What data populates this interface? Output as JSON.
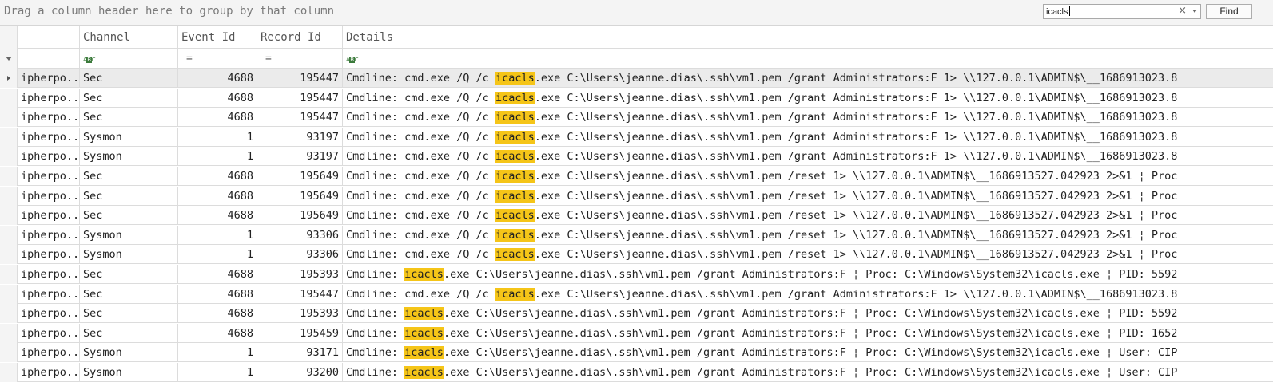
{
  "group_panel": {
    "hint": "Drag a column header here to group by that column"
  },
  "find": {
    "query": "icacls",
    "button_label": "Find"
  },
  "columns": {
    "c1": "",
    "c2": "Channel",
    "c3": "Event Id",
    "c4": "Record Id",
    "c5": "Details"
  },
  "filter_row": {
    "c3": "=",
    "c4": "="
  },
  "highlight_color": "#f5c518",
  "rows": [
    {
      "c1": "ipherpo...",
      "c2": "Sec",
      "c3": "4688",
      "c4": "195447",
      "pre": "Cmdline: cmd.exe /Q /c ",
      "hl": "icacls",
      "post": ".exe C:\\Users\\jeanne.dias\\.ssh\\vm1.pem /grant Administrators:F 1> \\\\127.0.0.1\\ADMIN$\\__1686913023.8"
    },
    {
      "c1": "ipherpo...",
      "c2": "Sec",
      "c3": "4688",
      "c4": "195447",
      "pre": "Cmdline: cmd.exe /Q /c ",
      "hl": "icacls",
      "post": ".exe C:\\Users\\jeanne.dias\\.ssh\\vm1.pem /grant Administrators:F 1> \\\\127.0.0.1\\ADMIN$\\__1686913023.8"
    },
    {
      "c1": "ipherpo...",
      "c2": "Sec",
      "c3": "4688",
      "c4": "195447",
      "pre": "Cmdline: cmd.exe /Q /c ",
      "hl": "icacls",
      "post": ".exe C:\\Users\\jeanne.dias\\.ssh\\vm1.pem /grant Administrators:F 1> \\\\127.0.0.1\\ADMIN$\\__1686913023.8"
    },
    {
      "c1": "ipherpo...",
      "c2": "Sysmon",
      "c3": "1",
      "c4": "93197",
      "pre": "Cmdline: cmd.exe /Q /c ",
      "hl": "icacls",
      "post": ".exe C:\\Users\\jeanne.dias\\.ssh\\vm1.pem /grant Administrators:F 1> \\\\127.0.0.1\\ADMIN$\\__1686913023.8"
    },
    {
      "c1": "ipherpo...",
      "c2": "Sysmon",
      "c3": "1",
      "c4": "93197",
      "pre": "Cmdline: cmd.exe /Q /c ",
      "hl": "icacls",
      "post": ".exe C:\\Users\\jeanne.dias\\.ssh\\vm1.pem /grant Administrators:F 1> \\\\127.0.0.1\\ADMIN$\\__1686913023.8"
    },
    {
      "c1": "ipherpo...",
      "c2": "Sec",
      "c3": "4688",
      "c4": "195649",
      "pre": "Cmdline: cmd.exe /Q /c ",
      "hl": "icacls",
      "post": ".exe C:\\Users\\jeanne.dias\\.ssh\\vm1.pem /reset 1> \\\\127.0.0.1\\ADMIN$\\__1686913527.042923 2>&1 ¦ Proc"
    },
    {
      "c1": "ipherpo...",
      "c2": "Sec",
      "c3": "4688",
      "c4": "195649",
      "pre": "Cmdline: cmd.exe /Q /c ",
      "hl": "icacls",
      "post": ".exe C:\\Users\\jeanne.dias\\.ssh\\vm1.pem /reset 1> \\\\127.0.0.1\\ADMIN$\\__1686913527.042923 2>&1 ¦ Proc"
    },
    {
      "c1": "ipherpo...",
      "c2": "Sec",
      "c3": "4688",
      "c4": "195649",
      "pre": "Cmdline: cmd.exe /Q /c ",
      "hl": "icacls",
      "post": ".exe C:\\Users\\jeanne.dias\\.ssh\\vm1.pem /reset 1> \\\\127.0.0.1\\ADMIN$\\__1686913527.042923 2>&1 ¦ Proc"
    },
    {
      "c1": "ipherpo...",
      "c2": "Sysmon",
      "c3": "1",
      "c4": "93306",
      "pre": "Cmdline: cmd.exe /Q /c ",
      "hl": "icacls",
      "post": ".exe C:\\Users\\jeanne.dias\\.ssh\\vm1.pem /reset 1> \\\\127.0.0.1\\ADMIN$\\__1686913527.042923 2>&1 ¦ Proc"
    },
    {
      "c1": "ipherpo...",
      "c2": "Sysmon",
      "c3": "1",
      "c4": "93306",
      "pre": "Cmdline: cmd.exe /Q /c ",
      "hl": "icacls",
      "post": ".exe C:\\Users\\jeanne.dias\\.ssh\\vm1.pem /reset 1> \\\\127.0.0.1\\ADMIN$\\__1686913527.042923 2>&1 ¦ Proc"
    },
    {
      "c1": "ipherpo...",
      "c2": "Sec",
      "c3": "4688",
      "c4": "195393",
      "pre": "Cmdline: ",
      "hl": "icacls",
      "post": ".exe C:\\Users\\jeanne.dias\\.ssh\\vm1.pem /grant Administrators:F ¦ Proc: C:\\Windows\\System32\\icacls.exe ¦ PID: 5592"
    },
    {
      "c1": "ipherpo...",
      "c2": "Sec",
      "c3": "4688",
      "c4": "195447",
      "pre": "Cmdline: cmd.exe /Q /c ",
      "hl": "icacls",
      "post": ".exe C:\\Users\\jeanne.dias\\.ssh\\vm1.pem /grant Administrators:F 1> \\\\127.0.0.1\\ADMIN$\\__1686913023.8"
    },
    {
      "c1": "ipherpo...",
      "c2": "Sec",
      "c3": "4688",
      "c4": "195393",
      "pre": "Cmdline: ",
      "hl": "icacls",
      "post": ".exe C:\\Users\\jeanne.dias\\.ssh\\vm1.pem /grant Administrators:F ¦ Proc: C:\\Windows\\System32\\icacls.exe ¦ PID: 5592"
    },
    {
      "c1": "ipherpo...",
      "c2": "Sec",
      "c3": "4688",
      "c4": "195459",
      "pre": "Cmdline: ",
      "hl": "icacls",
      "post": ".exe C:\\Users\\jeanne.dias\\.ssh\\vm1.pem /grant Administrators:F ¦ Proc: C:\\Windows\\System32\\icacls.exe ¦ PID: 1652"
    },
    {
      "c1": "ipherpo...",
      "c2": "Sysmon",
      "c3": "1",
      "c4": "93171",
      "pre": "Cmdline: ",
      "hl": "icacls",
      "post": ".exe C:\\Users\\jeanne.dias\\.ssh\\vm1.pem /grant Administrators:F ¦ Proc: C:\\Windows\\System32\\icacls.exe ¦ User: CIP"
    },
    {
      "c1": "ipherpo...",
      "c2": "Sysmon",
      "c3": "1",
      "c4": "93200",
      "pre": "Cmdline: ",
      "hl": "icacls",
      "post": ".exe C:\\Users\\jeanne.dias\\.ssh\\vm1.pem /grant Administrators:F ¦ Proc: C:\\Windows\\System32\\icacls.exe ¦ User: CIP"
    }
  ]
}
